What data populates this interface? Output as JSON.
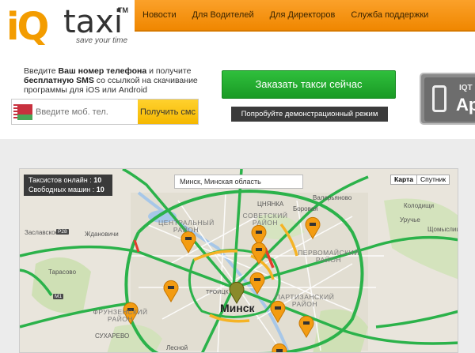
{
  "logo": {
    "iq": "iQ",
    "taxi": "taxi",
    "tm": "TM",
    "slogan": "save your time"
  },
  "nav": {
    "items": [
      "Новости",
      "Для Водителей",
      "Для Директоров",
      "Служба поддержки"
    ]
  },
  "promo": {
    "sms_part1": "Введите ",
    "sms_bold1": "Ваш номер телефона",
    "sms_part2": " и получите ",
    "sms_bold2": "бесплатную SMS",
    "sms_part3": " со ссылкой на скачивание программы для iOS или Android",
    "phone_placeholder": "Введите моб. тел.",
    "get_sms_label": "Получить смс",
    "order_label": "Заказать такси сейчас",
    "demo_label": "Попробуйте демонстрационный режим",
    "app_badge_small": "IQT",
    "app_badge_large": "Ap"
  },
  "map": {
    "stats_online_label": "Таксистов онлайн :",
    "stats_online_value": "10",
    "stats_free_label": "Свободных машин :",
    "stats_free_value": "10",
    "search_value": "Минск, Минская область",
    "type_map": "Карта",
    "type_satellite": "Спутник",
    "labels": {
      "city": "Минск",
      "central": "ЦЕНТРАЛЬНЫЙ РАЙОН",
      "sovetsky": "СОВЕТСКИЙ РАЙОН",
      "pervomaisky": "ПЕРВОМАЙСКИЙ РАЙОН",
      "partizansky": "ПАРТИЗАНСКИЙ РАЙОН",
      "frunzensky": "ФРУНЗЕНСКИЙ РАЙОН",
      "zhdanovichi": "Ждановичи",
      "tarasovo": "Тарасово",
      "valeryanovo": "Валерьяново",
      "borovaya": "Боровая",
      "tsnyanka": "ЦНЯНКА",
      "zaslavsky": "Заславское",
      "kolodishchi": "Колодищи",
      "uruchye": "Уручье",
      "shchomyslitsa": "Щомыслица",
      "sukharevo": "СУХАРЕВО",
      "lesnoy": "Лесной",
      "trinity": "ТРОИЦК",
      "r28": "Р28",
      "m1": "М1"
    }
  }
}
